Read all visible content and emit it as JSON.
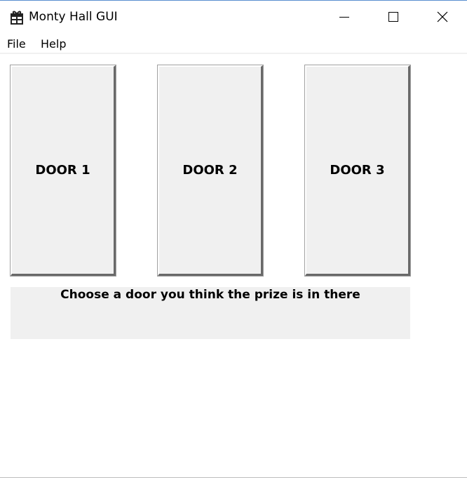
{
  "window": {
    "title": "Monty Hall GUI",
    "icon": "gift-icon",
    "controls": [
      "minimize-icon",
      "maximize-icon",
      "close-icon"
    ]
  },
  "menu": {
    "items": [
      {
        "label": "File"
      },
      {
        "label": "Help"
      }
    ]
  },
  "doors": [
    {
      "label": "DOOR 1"
    },
    {
      "label": "DOOR 2"
    },
    {
      "label": "DOOR 3"
    }
  ],
  "message": {
    "text": "Choose a door you think the prize is in there"
  },
  "colors": {
    "panel_background": "#f0f0f0",
    "window_background": "#ffffff",
    "button_shadow": "#696969"
  }
}
